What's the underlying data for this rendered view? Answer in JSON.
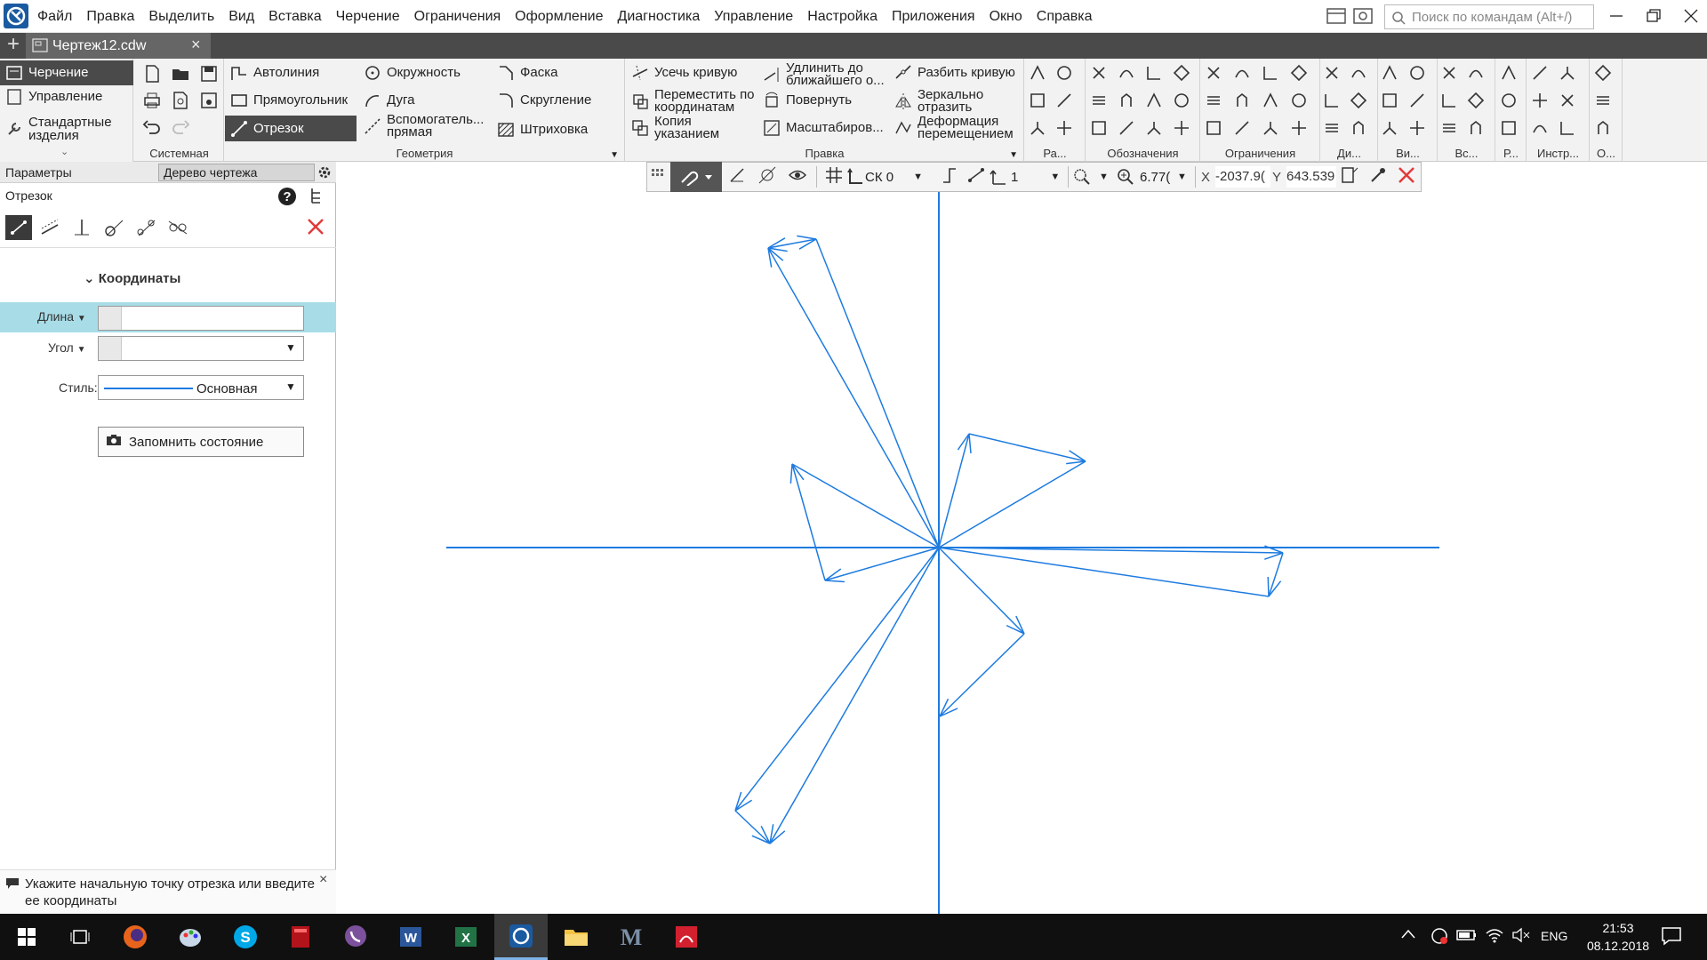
{
  "menu": [
    "Файл",
    "Правка",
    "Выделить",
    "Вид",
    "Вставка",
    "Черчение",
    "Ограничения",
    "Оформление",
    "Диагностика",
    "Управление",
    "Настройка",
    "Приложения",
    "Окно",
    "Справка"
  ],
  "search": {
    "placeholder": "Поиск по командам (Alt+/)"
  },
  "tab": {
    "title": "Чертеж12.cdw"
  },
  "ribbon": {
    "modes": [
      "Черчение",
      "Управление",
      "Стандартные изделия"
    ],
    "sections": {
      "system": "Системная",
      "geometry": "Геометрия",
      "edit": "Правка",
      "ra": "Ра...",
      "notation": "Обозначения",
      "constraints": "Ограничения",
      "di": "Ди...",
      "vi": "Ви...",
      "vs": "Вс...",
      "r": "Р...",
      "instr": "Инстр...",
      "o": "О..."
    },
    "geometry": {
      "col1": [
        "Автолиния",
        "Прямоугольник",
        "Отрезок"
      ],
      "col2": [
        "Окружность",
        "Дуга",
        "Вспомогатель... прямая"
      ],
      "col3": [
        "Фаска",
        "Скругление",
        "Штриховка"
      ]
    },
    "edit": {
      "col1": [
        "Усечь кривую",
        "Переместить по координатам",
        "Копия указанием"
      ],
      "col2": [
        "Удлинить до ближайшего о...",
        "Повернуть",
        "Масштабиров..."
      ],
      "col3": [
        "Разбить кривую",
        "Зеркально отразить",
        "Деформация перемещением"
      ]
    }
  },
  "canvas_toolbar": {
    "cs": "СК 0",
    "layer": "1",
    "zoom": "6.77(",
    "x_label": "X",
    "x_value": "-2037.9(",
    "y_label": "Y",
    "y_value": "643.539"
  },
  "left_panel": {
    "tab_params": "Параметры",
    "tab_tree": "Дерево чертежа",
    "title": "Отрезок",
    "section": "Координаты",
    "length_label": "Длина",
    "length_value": "",
    "angle_label": "Угол",
    "angle_value": "",
    "style_label": "Стиль:",
    "style_value": "Основная",
    "remember_button": "Запомнить состояние",
    "status": "Укажите начальную точку отрезка или введите ее координаты"
  },
  "taskbar": {
    "lang": "ENG",
    "time": "21:53",
    "date": "08.12.2018"
  },
  "colors": {
    "drawing": "#1e7be0",
    "accent": "#1a5aa0"
  }
}
